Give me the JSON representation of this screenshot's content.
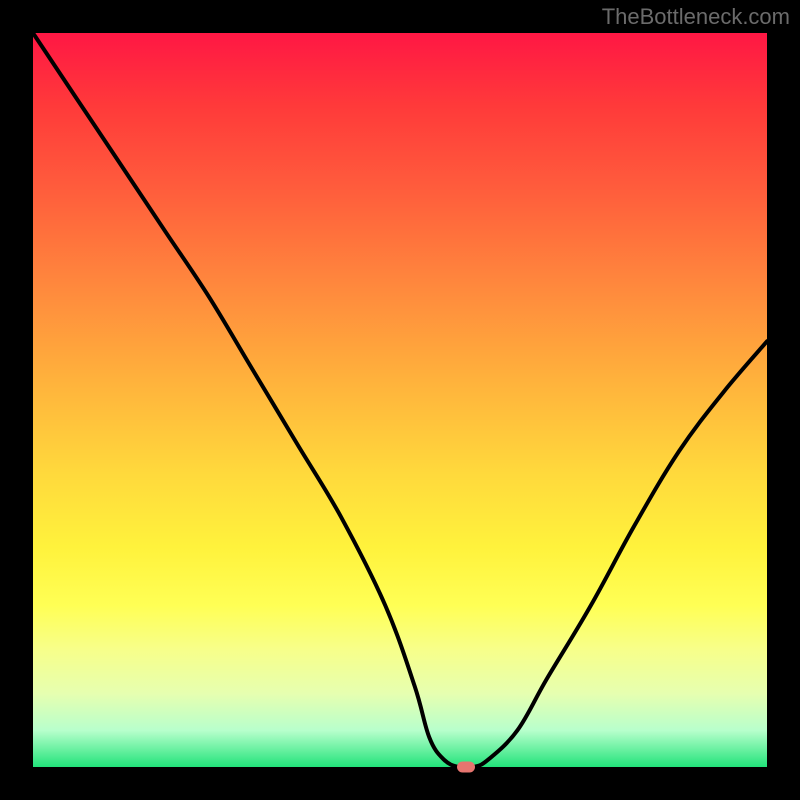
{
  "watermark": "TheBottleneck.com",
  "chart_data": {
    "type": "line",
    "title": "",
    "xlabel": "",
    "ylabel": "",
    "xlim": [
      0,
      100
    ],
    "ylim": [
      0,
      100
    ],
    "series": [
      {
        "name": "curve",
        "x": [
          0,
          6,
          12,
          18,
          24,
          30,
          36,
          42,
          48,
          52,
          54,
          56,
          58,
          60,
          62,
          66,
          70,
          76,
          82,
          88,
          94,
          100
        ],
        "values": [
          100,
          91,
          82,
          73,
          64,
          54,
          44,
          34,
          22,
          11,
          4,
          1,
          0,
          0,
          1,
          5,
          12,
          22,
          33,
          43,
          51,
          58
        ]
      }
    ],
    "marker": {
      "x": 59,
      "y": 0,
      "color": "#e6756f"
    },
    "gradient_stops": [
      {
        "pos": 0,
        "color": "#ff1744"
      },
      {
        "pos": 50,
        "color": "#ffd93c"
      },
      {
        "pos": 80,
        "color": "#ffff55"
      },
      {
        "pos": 100,
        "color": "#22e37a"
      }
    ]
  }
}
